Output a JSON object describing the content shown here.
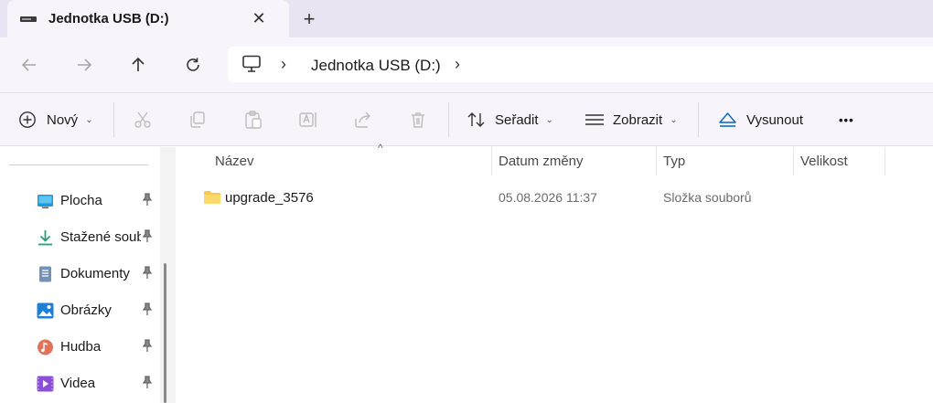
{
  "tab": {
    "title": "Jednotka USB (D:)",
    "close_symbol": "✕",
    "new_tab_symbol": "+"
  },
  "address": {
    "separator": "›",
    "crumb": "Jednotka USB (D:)",
    "trailing_separator": "›"
  },
  "commands": {
    "new_label": "Nový",
    "sort_label": "Seřadit",
    "view_label": "Zobrazit",
    "eject_label": "Vysunout",
    "more_symbol": "•••",
    "chevron": "⌄"
  },
  "sidebar": {
    "items": [
      {
        "label": "Plocha",
        "icon": "desktop-icon"
      },
      {
        "label": "Stažené soubory",
        "icon": "download-icon"
      },
      {
        "label": "Dokumenty",
        "icon": "documents-icon"
      },
      {
        "label": "Obrázky",
        "icon": "pictures-icon"
      },
      {
        "label": "Hudba",
        "icon": "music-icon"
      },
      {
        "label": "Videa",
        "icon": "videos-icon"
      }
    ]
  },
  "table": {
    "columns": [
      "Název",
      "Datum změny",
      "Typ",
      "Velikost"
    ],
    "sort_indicator": "^",
    "rows": [
      {
        "name": "upgrade_3576",
        "modified": "05.08.2026 11:37",
        "type": "Složka souborů",
        "size": ""
      }
    ]
  },
  "colors": {
    "accent": "#0067c0",
    "folder": "#f8c94a",
    "chrome": "#f7f5fb",
    "tabstrip": "#e9e4f2"
  }
}
